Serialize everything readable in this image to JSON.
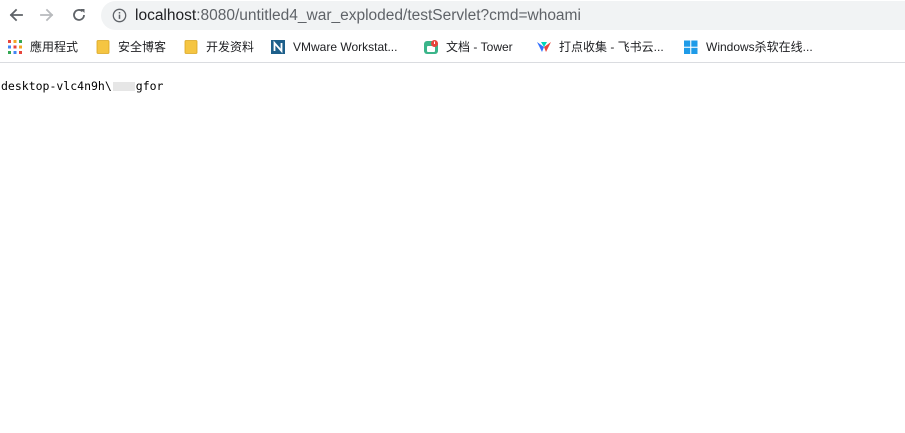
{
  "toolbar": {
    "back_icon": "back-arrow-icon",
    "forward_icon": "forward-arrow-icon",
    "reload_icon": "reload-icon",
    "info_icon": "info-icon",
    "url_host": "localhost",
    "url_rest": ":8080/untitled4_war_exploded/testServlet?cmd=whoami"
  },
  "bookmarks": [
    {
      "label": "應用程式",
      "icon": "apps-grid-icon"
    },
    {
      "label": "安全博客",
      "icon": "folder-icon"
    },
    {
      "label": "开发资料",
      "icon": "folder-icon"
    },
    {
      "label": "VMware Workstat...",
      "icon": "vmware-icon"
    },
    {
      "label": "文档 - Tower",
      "icon": "tower-icon"
    },
    {
      "label": "打点收集 - 飞书云...",
      "icon": "feishu-icon"
    },
    {
      "label": "Windows杀软在线...",
      "icon": "windows-icon"
    }
  ],
  "output": {
    "prefix": "desktop-vlc4n9h\\",
    "suffix": "gfor"
  },
  "colors": {
    "omnibox_bg": "#f1f3f4",
    "folder": "#f5c542",
    "vmware": "#1d5f8a",
    "tower_red": "#e8453c",
    "feishu": "#3370ff",
    "windows": "#1e9be8"
  }
}
